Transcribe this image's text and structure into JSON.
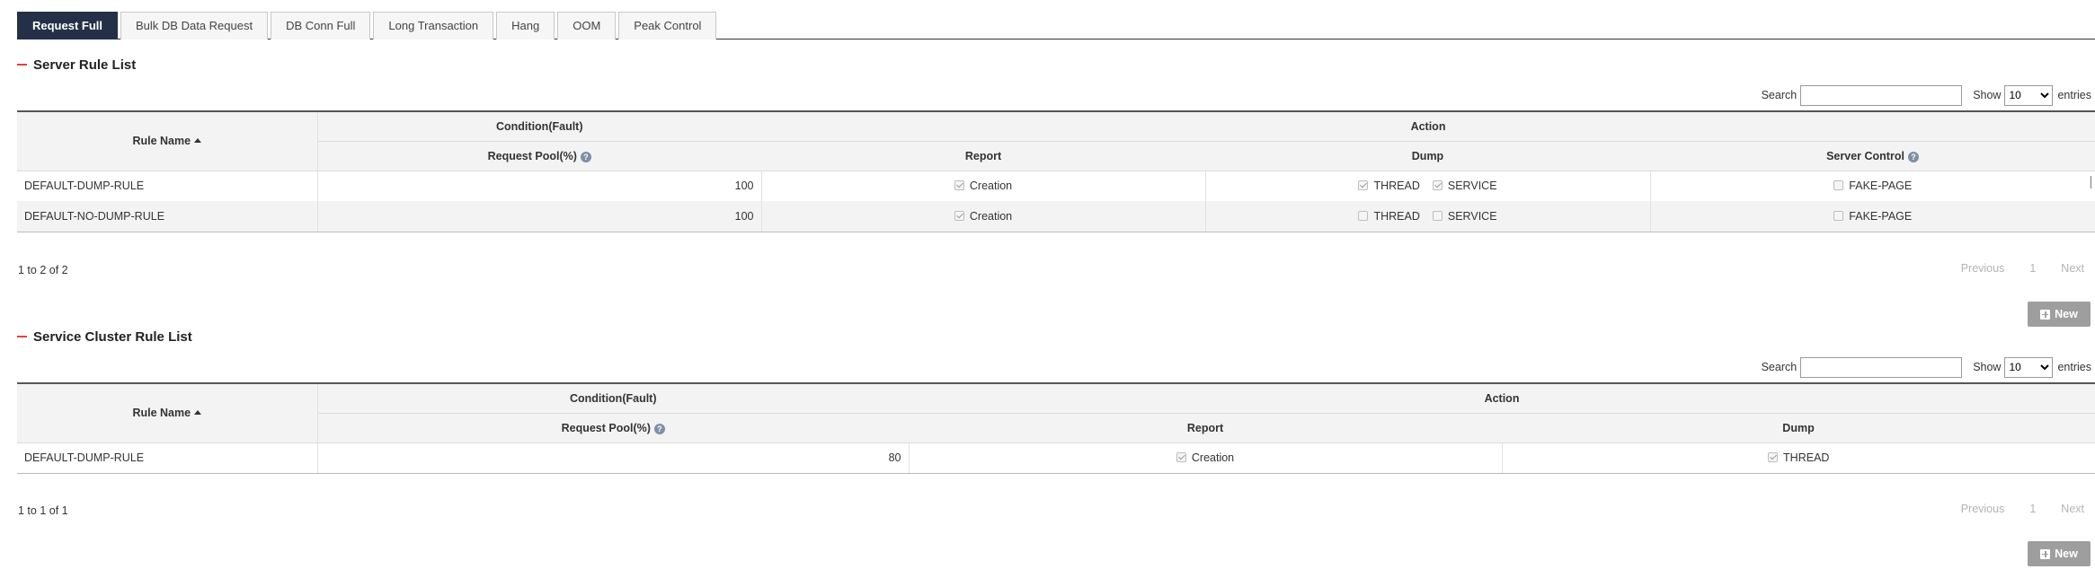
{
  "tabs": [
    {
      "label": "Request Full",
      "active": true
    },
    {
      "label": "Bulk DB Data Request",
      "active": false
    },
    {
      "label": "DB Conn Full",
      "active": false
    },
    {
      "label": "Long Transaction",
      "active": false
    },
    {
      "label": "Hang",
      "active": false
    },
    {
      "label": "OOM",
      "active": false
    },
    {
      "label": "Peak Control",
      "active": false
    }
  ],
  "common": {
    "search_label": "Search",
    "show_label": "Show",
    "entries_label": "entries",
    "entries_value": "10",
    "rule_name_header": "Rule Name",
    "condition_header": "Condition(Fault)",
    "action_header": "Action",
    "request_pool_header": "Request Pool(%)",
    "report_header": "Report",
    "dump_header": "Dump",
    "server_control_header": "Server Control",
    "previous": "Previous",
    "page": "1",
    "next": "Next",
    "new_label": "New",
    "help_glyph": "?"
  },
  "server_rules": {
    "title": "Server Rule List",
    "rows": [
      {
        "name": "DEFAULT-DUMP-RULE",
        "pool": "100",
        "report_label": "Creation",
        "report": true,
        "thread_label": "THREAD",
        "thread": true,
        "service_label": "SERVICE",
        "service": true,
        "control_label": "FAKE-PAGE",
        "control": false
      },
      {
        "name": "DEFAULT-NO-DUMP-RULE",
        "pool": "100",
        "report_label": "Creation",
        "report": true,
        "thread_label": "THREAD",
        "thread": false,
        "service_label": "SERVICE",
        "service": false,
        "control_label": "FAKE-PAGE",
        "control": false
      }
    ],
    "info": "1 to 2 of 2"
  },
  "cluster_rules": {
    "title": "Service Cluster Rule List",
    "rows": [
      {
        "name": "DEFAULT-DUMP-RULE",
        "pool": "80",
        "report_label": "Creation",
        "report": true,
        "thread_label": "THREAD",
        "thread": true
      }
    ],
    "info": "1 to 1 of 1"
  }
}
